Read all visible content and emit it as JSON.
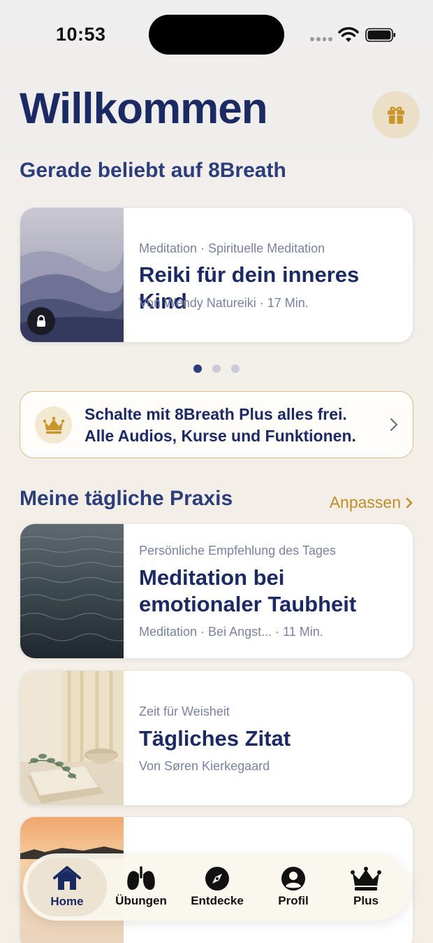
{
  "status_bar": {
    "time": "10:53"
  },
  "header": {
    "title": "Willkommen"
  },
  "popular": {
    "title": "Gerade beliebt auf 8Breath",
    "card": {
      "meta": "Meditation · Spirituelle Meditation",
      "name": "Reiki für dein inneres Kind",
      "sub": "Von Wendy Natureiki · 17 Min."
    },
    "page_index": 1,
    "page_count": 3
  },
  "promo": {
    "line1": "Schalte mit 8Breath Plus alles frei.",
    "line2": "Alle Audios, Kurse und Funktionen."
  },
  "daily": {
    "title": "Meine tägliche Praxis",
    "customize_label": "Anpassen",
    "cards": [
      {
        "meta": "Persönliche Empfehlung des Tages",
        "name_line1": "Meditation bei",
        "name_line2": "emotionaler Taubheit",
        "sub": "Meditation · Bei Angst... · 11 Min."
      },
      {
        "meta": "Zeit für Weisheit",
        "name": "Tägliches Zitat",
        "sub": "Von Søren Kierkegaard"
      }
    ]
  },
  "tabbar": {
    "tabs": [
      {
        "label": "Home",
        "icon": "home-icon",
        "active": true
      },
      {
        "label": "Übungen",
        "icon": "lungs-icon",
        "active": false
      },
      {
        "label": "Entdecke",
        "icon": "compass-icon",
        "active": false
      },
      {
        "label": "Profil",
        "icon": "profile-icon",
        "active": false
      },
      {
        "label": "Plus",
        "icon": "crown-icon",
        "active": false
      }
    ]
  },
  "colors": {
    "primary": "#1c2a64",
    "accent_gold": "#bf8d26",
    "muted_text": "#7a82a3"
  }
}
